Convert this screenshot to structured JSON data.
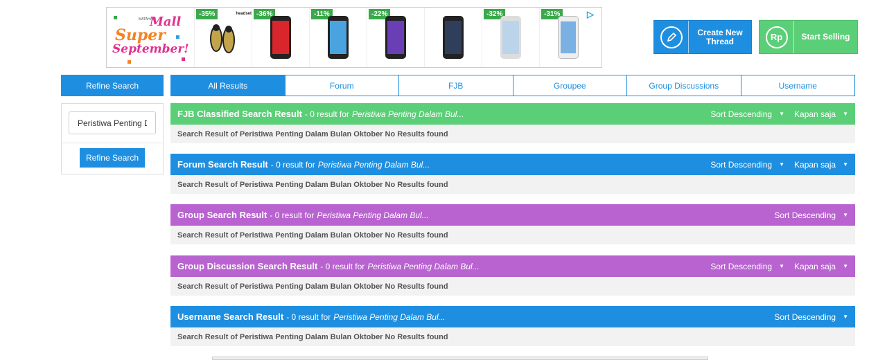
{
  "ad_top": {
    "logo": {
      "mall": "Mall",
      "small": "MATAHARI",
      "super": "Super",
      "september": "September!"
    },
    "products": [
      {
        "discount": "-35%",
        "label": "headset",
        "color": "#c4a44a"
      },
      {
        "discount": "-36%",
        "color": "#d9262c"
      },
      {
        "discount": "-11%",
        "color": "#4aa3df"
      },
      {
        "discount": "-22%",
        "color": "#6a3fb5"
      },
      {
        "discount": "",
        "color": "#2f3e5a"
      },
      {
        "discount": "-32%",
        "color": "#bcd4ea"
      },
      {
        "discount": "-31%",
        "color": "#7bb0e3"
      }
    ],
    "adchoices_icon": "adchoices-icon"
  },
  "actions": {
    "create_thread": {
      "label": "Create New Thread",
      "icon": "pencil-icon"
    },
    "start_selling": {
      "label": "Start Selling",
      "icon_text": "Rp"
    }
  },
  "refine": {
    "header": "Refine Search",
    "input_value": "Peristiwa Penting Dalam Bulan Oktober",
    "button": "Refine Search"
  },
  "tabs": [
    {
      "label": "All Results"
    },
    {
      "label": "Forum"
    },
    {
      "label": "FJB"
    },
    {
      "label": "Groupee"
    },
    {
      "label": "Group Discussions"
    },
    {
      "label": "Username"
    }
  ],
  "sections": [
    {
      "title": "FJB Classified Search Result",
      "count": "- 0 result for",
      "query": "Peristiwa Penting Dalam Bul...",
      "sort": "Sort Descending",
      "time": "Kapan saja",
      "body": "Search Result of Peristiwa Penting Dalam Bulan Oktober No Results found",
      "color": "#5bcf77"
    },
    {
      "title": "Forum Search Result",
      "count": "- 0 result for",
      "query": "Peristiwa Penting Dalam Bul...",
      "sort": "Sort Descending",
      "time": "Kapan saja",
      "body": "Search Result of Peristiwa Penting Dalam Bulan Oktober No Results found",
      "color": "#1e8fe0"
    },
    {
      "title": "Group Search Result",
      "count": "- 0 result for",
      "query": "Peristiwa Penting Dalam Bul...",
      "sort": "Sort Descending",
      "time": null,
      "body": "Search Result of Peristiwa Penting Dalam Bulan Oktober No Results found",
      "color": "#b863cf"
    },
    {
      "title": "Group Discussion Search Result",
      "count": "- 0 result for",
      "query": "Peristiwa Penting Dalam Bul...",
      "sort": "Sort Descending",
      "time": "Kapan saja",
      "body": "Search Result of Peristiwa Penting Dalam Bulan Oktober No Results found",
      "color": "#b863cf"
    },
    {
      "title": "Username Search Result",
      "count": "- 0 result for",
      "query": "Peristiwa Penting Dalam Bul...",
      "sort": "Sort Descending",
      "time": null,
      "body": "Search Result of Peristiwa Penting Dalam Bulan Oktober No Results found",
      "color": "#1e8fe0"
    }
  ]
}
